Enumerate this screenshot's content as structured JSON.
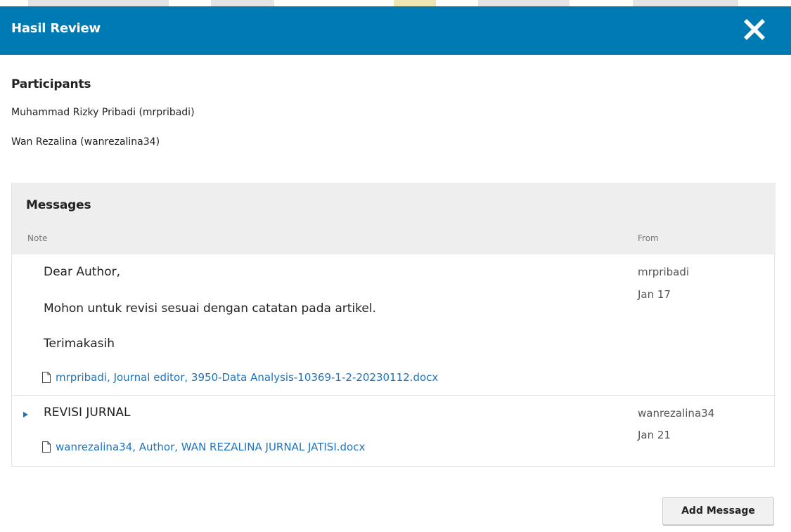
{
  "modal": {
    "title": "Hasil Review"
  },
  "participants": {
    "heading": "Participants",
    "list": [
      "Muhammad Rizky Pribadi (mrpribadi)",
      "Wan Rezalina (wanrezalina34)"
    ]
  },
  "messages": {
    "heading": "Messages",
    "columns": {
      "note": "Note",
      "from": "From"
    },
    "rows": [
      {
        "lines": [
          "Dear Author,",
          "Mohon untuk revisi sesuai dengan catatan pada artikel.",
          "Terimakasih"
        ],
        "file": "mrpribadi, Journal editor, 3950-Data Analysis-10369-1-2-20230112.docx",
        "from": "mrpribadi",
        "date": "Jan 17"
      },
      {
        "lines": [
          "REVISI JURNAL"
        ],
        "file": "wanrezalina34, Author, WAN REZALINA JURNAL JATISI.docx",
        "from": "wanrezalina34",
        "date": "Jan 21"
      }
    ]
  },
  "actions": {
    "add_message": "Add Message"
  },
  "icons": {
    "close": "close-icon",
    "file": "file-icon",
    "expand": "expand-triangle-icon"
  },
  "colors": {
    "header_bg": "#007ab2",
    "link": "#1e73be",
    "panel_bg": "#eeeeee"
  }
}
